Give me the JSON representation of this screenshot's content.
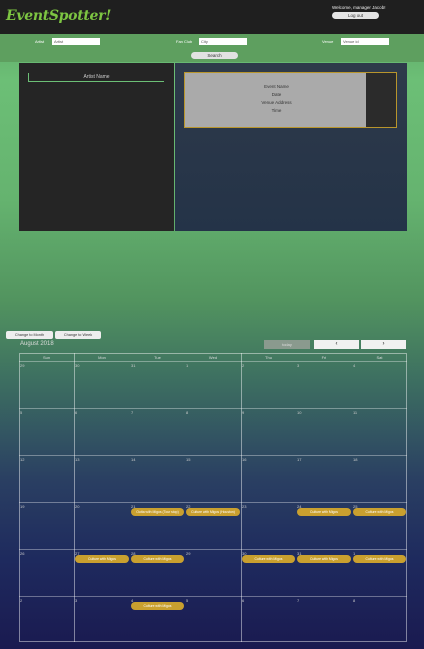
{
  "header": {
    "logo": "EventSpotter!",
    "welcome": "Welcome, manager Jacob!",
    "logout_label": "Log out"
  },
  "filters": {
    "artist_label": "Artist",
    "artist_value": "Artist",
    "city_label": "Fan Club",
    "city_value": "City",
    "venue_label": "Venue",
    "venue_value": "Venue id",
    "search_label": "Search"
  },
  "artist_panel": {
    "heading": "Artist Name"
  },
  "event_card": {
    "name": "Event Name",
    "date": "Date",
    "venue": "Venue Address",
    "time": "Time"
  },
  "calendar": {
    "month_button": "Change to Month",
    "week_button": "Change to Week",
    "month_title": "August 2018",
    "today_label": "today",
    "prev_icon": "‹",
    "next_icon": "›",
    "weekdays": [
      "Sun",
      "Mon",
      "Tue",
      "Wed",
      "Thu",
      "Fri",
      "Sat"
    ],
    "days": [
      "29",
      "30",
      "31",
      "1",
      "2",
      "3",
      "4",
      "5",
      "6",
      "7",
      "8",
      "9",
      "10",
      "11",
      "12",
      "13",
      "14",
      "15",
      "16",
      "17",
      "18",
      "19",
      "20",
      "21",
      "22",
      "23",
      "24",
      "25",
      "26",
      "27",
      "28",
      "29",
      "30",
      "31",
      "1",
      "2",
      "3",
      "4",
      "5",
      "6",
      "7",
      "8"
    ],
    "events": [
      "Outta with Migos (Tour stop)",
      "Culture with Migos (Houston)",
      "Culture with Migos",
      "Culture with Migos",
      "Culture with Migos",
      "Culture with Migos",
      "Culture with Migos",
      "Culture with Migos",
      "Culture with Migos",
      "Culture with Migos"
    ]
  },
  "colors": {
    "accent": "#7dc542",
    "event": "#c9a02f",
    "header": "#1f1f1f"
  }
}
